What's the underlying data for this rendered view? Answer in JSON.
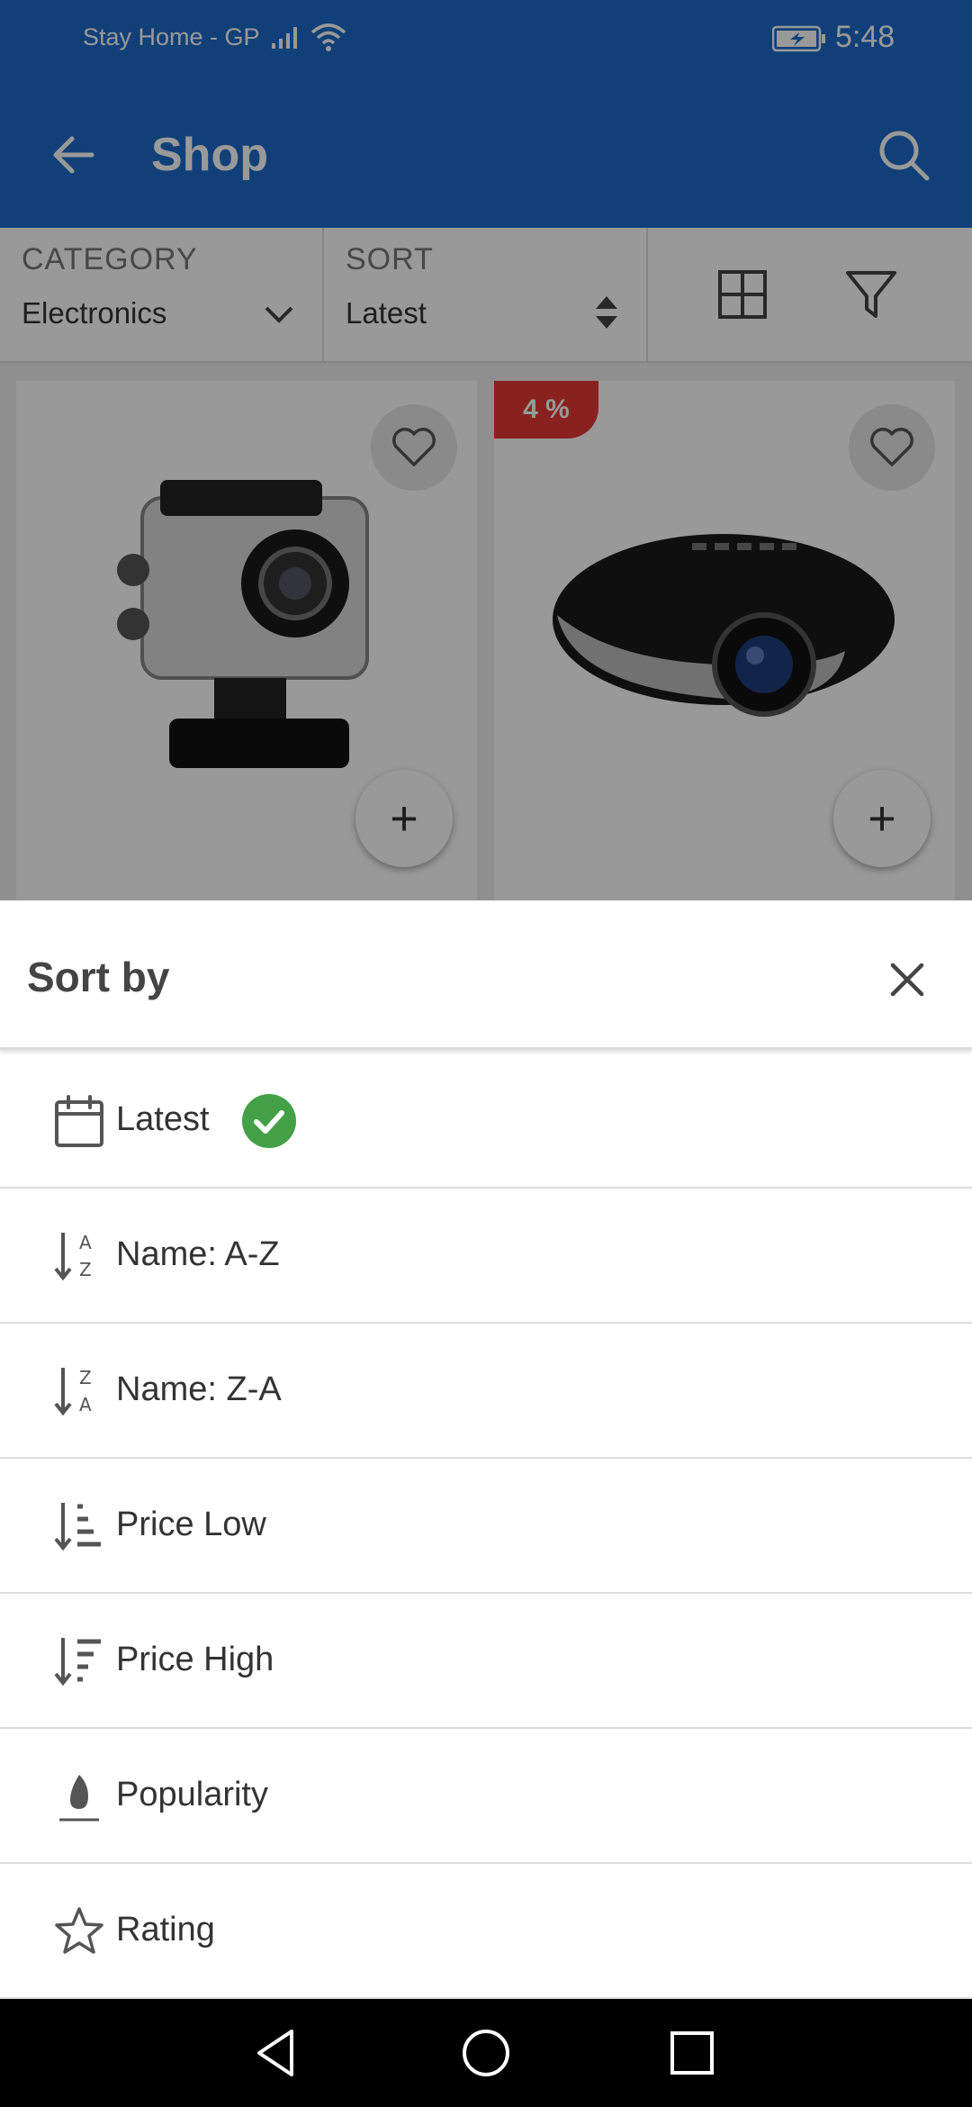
{
  "status_bar": {
    "carrier": "Stay Home - GP",
    "time": "5:48"
  },
  "app_bar": {
    "title": "Shop"
  },
  "filters": {
    "category": {
      "label": "CATEGORY",
      "value": "Electronics"
    },
    "sort": {
      "label": "SORT",
      "value": "Latest"
    }
  },
  "products": [
    {
      "discount": ""
    },
    {
      "discount": "4 %"
    }
  ],
  "sheet": {
    "title": "Sort by",
    "options": [
      {
        "label": "Latest",
        "icon": "calendar-icon",
        "selected": true
      },
      {
        "label": "Name: A-Z",
        "icon": "sort-alpha-asc-icon",
        "selected": false
      },
      {
        "label": "Name: Z-A",
        "icon": "sort-alpha-desc-icon",
        "selected": false
      },
      {
        "label": "Price Low",
        "icon": "sort-amount-asc-icon",
        "selected": false
      },
      {
        "label": "Price High",
        "icon": "sort-amount-desc-icon",
        "selected": false
      },
      {
        "label": "Popularity",
        "icon": "fire-icon",
        "selected": false
      },
      {
        "label": "Rating",
        "icon": "star-outline-icon",
        "selected": false
      }
    ]
  },
  "colors": {
    "primary": "#1d6cc8",
    "badge": "#e53935",
    "check": "#43a047"
  }
}
